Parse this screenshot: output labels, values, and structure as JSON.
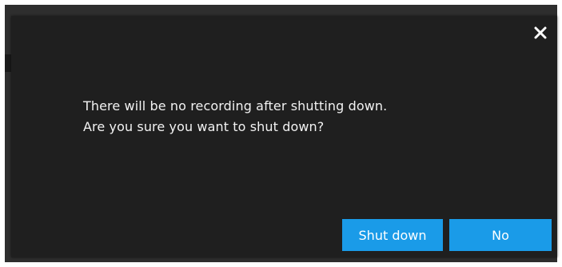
{
  "dialog": {
    "close_icon": "close-icon",
    "message_lines": [
      "There will be no recording after shutting down.",
      "Are you sure you want to shut down?"
    ],
    "buttons": {
      "shutdown_label": "Shut down",
      "no_label": "No"
    }
  },
  "colors": {
    "dialog_background": "#1f1f1f",
    "backdrop": "#2e2e2e",
    "text": "#f2f2f2",
    "primary_button": "#1a9be8"
  }
}
